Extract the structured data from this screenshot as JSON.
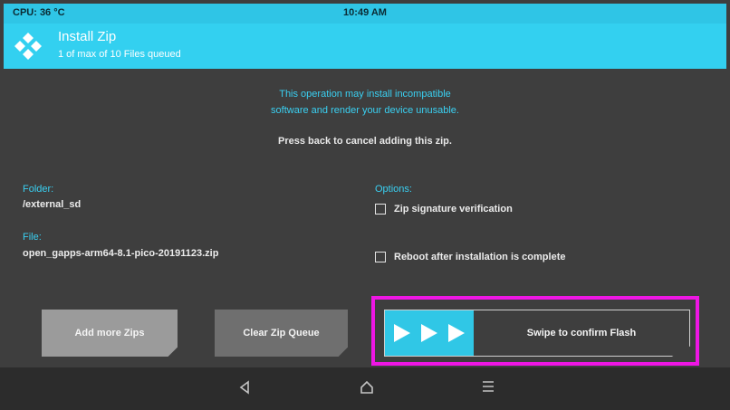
{
  "status": {
    "cpu": "CPU: 36 °C",
    "time": "10:49 AM"
  },
  "header": {
    "title": "Install Zip",
    "subtitle": "1 of max of 10 Files queued",
    "logo_icon": "twrp-logo-icon"
  },
  "warning": {
    "line1": "This operation may install incompatible",
    "line2": "software and render your device unusable."
  },
  "press_back": "Press back to cancel adding this zip.",
  "folder": {
    "label": "Folder:",
    "value": "/external_sd"
  },
  "file": {
    "label": "File:",
    "value": "open_gapps-arm64-8.1-pico-20191123.zip"
  },
  "options": {
    "label": "Options:",
    "zip_sig": {
      "label": "Zip signature verification",
      "checked": false
    },
    "reboot": {
      "label": "Reboot after installation is complete",
      "checked": false
    }
  },
  "buttons": {
    "add_more": "Add more Zips",
    "clear_queue": "Clear Zip Queue"
  },
  "swipe": {
    "label": "Swipe to confirm Flash",
    "arrow_icon": "arrow-right-icon"
  },
  "nav": {
    "back_icon": "back-icon",
    "home_icon": "home-icon",
    "menu_icon": "menu-icon"
  },
  "colors": {
    "accent": "#33d0f0",
    "highlight": "#ee16e4",
    "background": "#3e3e3e"
  }
}
